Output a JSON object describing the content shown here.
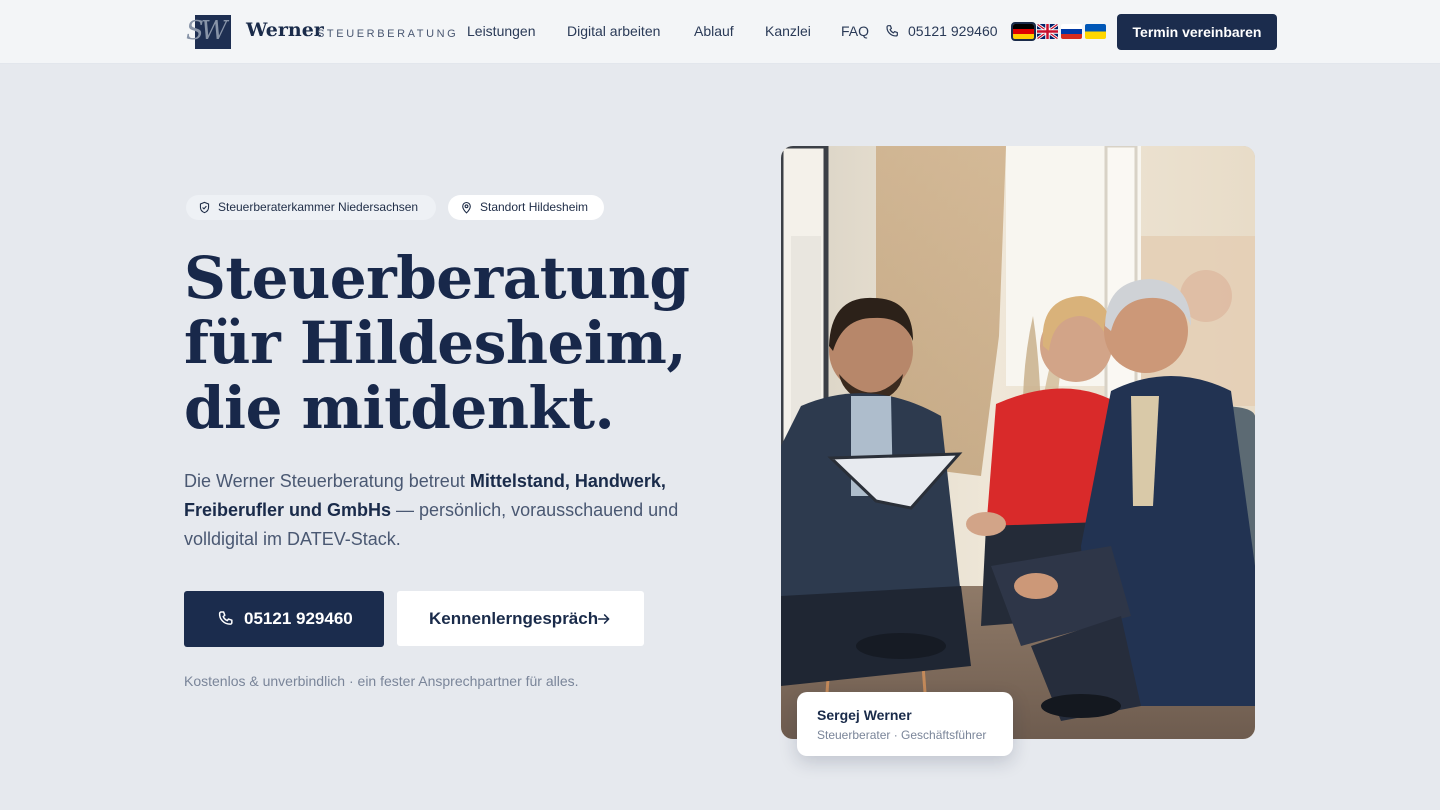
{
  "header": {
    "logo_monogram": "SW",
    "logo_name": "Werner",
    "logo_sub": "STEUERBERATUNG",
    "nav": [
      "Leistungen",
      "Digital arbeiten",
      "Ablauf",
      "Kanzlei",
      "FAQ"
    ],
    "phone": "05121 929460",
    "languages": [
      "de",
      "en",
      "ru",
      "uk"
    ],
    "active_language": "de",
    "cta": "Termin vereinbaren"
  },
  "hero": {
    "badges": [
      "Steuerberaterkammer Niedersachsen",
      "Standort Hildesheim"
    ],
    "headline": "Steuerberatung für Hildesheim, die mitdenkt.",
    "lead_prefix": "Die Werner Steuerberatung betreut ",
    "lead_bold": "Mittelstand, Handwerk, Freiberufler und GmbHs",
    "lead_suffix": " — persönlich, vorausschauend und volldigital im DATEV-Stack.",
    "btn_phone": "05121 929460",
    "btn_meet": "Kennenlerngespräch",
    "note": "Kostenlos & unverbindlich · ein fester Ansprechpartner für alles."
  },
  "card": {
    "name": "Sergej Werner",
    "role": "Steuerberater · Geschäftsführer"
  },
  "colors": {
    "navy": "#1b2c4d",
    "background": "#e6e9ee",
    "header_bg": "#f3f5f7"
  },
  "icons": [
    "phone-icon",
    "shield-icon",
    "location-pin-icon",
    "arrow-right-icon"
  ]
}
